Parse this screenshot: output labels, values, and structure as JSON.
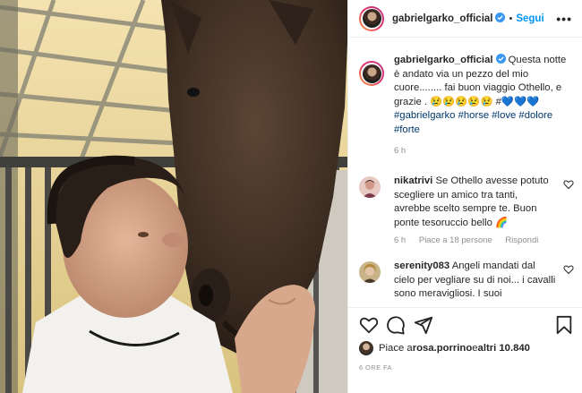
{
  "post": {
    "username": "gabrielgarko_official",
    "separator": "•",
    "follow_label": "Segui",
    "more_label": "•••",
    "caption_text": "Questa notte è andato via un pezzo del mio cuore........ fai buon viaggio Othello, e grazie . 😢😢😢😢😢 #💙💙💙",
    "caption_tags": "#gabrielgarko #horse #love #dolore #forte",
    "caption_time": "6 h"
  },
  "comments": [
    {
      "username": "nikatrivi",
      "text": "Se Othello avesse potuto scegliere un amico tra tanti, avrebbe scelto sempre te. Buon ponte tesoruccio bello 🌈",
      "time": "6 h",
      "likes": "Piace a 18 persone",
      "reply": "Rispondi"
    },
    {
      "username": "serenity083",
      "text": "Angeli mandati dal cielo per vegliare su di noi... i cavalli sono meravigliosi. I suoi"
    }
  ],
  "footer": {
    "likes_prefix": "Piace a ",
    "likes_user": "rosa.porrino",
    "likes_middle": " e ",
    "likes_others": "altri 10.840",
    "post_time": "6 ORE FA"
  },
  "colors": {
    "link": "#0095f6",
    "hashtag": "#00376b",
    "muted": "#8e8e8e",
    "text": "#262626"
  },
  "icons": [
    "heart-icon",
    "comment-icon",
    "share-icon",
    "bookmark-icon",
    "more-options-icon",
    "verified-badge-icon"
  ]
}
